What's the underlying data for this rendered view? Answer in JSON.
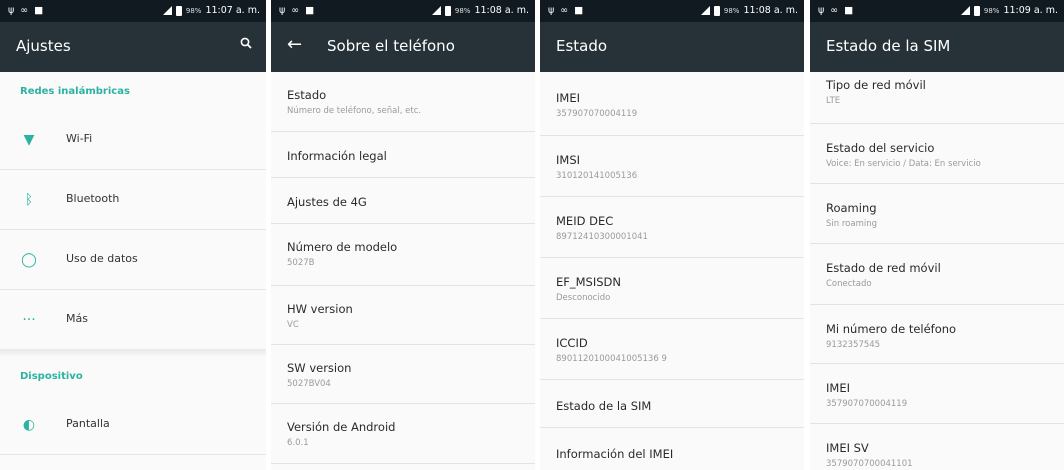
{
  "statusbar": {
    "battery": "98%",
    "times": [
      "11:07 a. m.",
      "11:08 a. m.",
      "11:08 a. m.",
      "11:09 a. m."
    ]
  },
  "screen1": {
    "title": "Ajustes",
    "section_wireless": "Redes inalámbricas",
    "items": [
      "Wi-Fi",
      "Bluetooth",
      "Uso de datos",
      "Más"
    ],
    "section_device": "Dispositivo",
    "device_items": [
      "Pantalla"
    ]
  },
  "screen2": {
    "title": "Sobre el teléfono",
    "items": [
      {
        "title": "Estado",
        "sub": "Número de teléfono, señal, etc."
      },
      {
        "title": "Información legal",
        "sub": ""
      },
      {
        "title": "Ajustes de 4G",
        "sub": ""
      },
      {
        "title": "Número de modelo",
        "sub": "5027B"
      },
      {
        "title": "HW version",
        "sub": "VC"
      },
      {
        "title": "SW version",
        "sub": "5027BV04"
      },
      {
        "title": "Versión de Android",
        "sub": "6.0.1"
      }
    ]
  },
  "screen3": {
    "title": "Estado",
    "items": [
      {
        "title": "IMEI",
        "sub": "357907070004119"
      },
      {
        "title": "IMSI",
        "sub": "310120141005136"
      },
      {
        "title": "MEID DEC",
        "sub": "89712410300001041"
      },
      {
        "title": "EF_MSISDN",
        "sub": "Desconocido"
      },
      {
        "title": "ICCID",
        "sub": "8901120100041005136 9"
      },
      {
        "title": "Estado de la SIM",
        "sub": ""
      },
      {
        "title": "Información del IMEI",
        "sub": ""
      }
    ]
  },
  "screen4": {
    "title": "Estado de la SIM",
    "items": [
      {
        "title": "Tipo de red móvil",
        "sub": "LTE"
      },
      {
        "title": "Estado del servicio",
        "sub": "Voice: En servicio / Data: En servicio"
      },
      {
        "title": "Roaming",
        "sub": "Sin roaming"
      },
      {
        "title": "Estado de red móvil",
        "sub": "Conectado"
      },
      {
        "title": "Mi número de teléfono",
        "sub": "9132357545"
      },
      {
        "title": "IMEI",
        "sub": "357907070004119"
      },
      {
        "title": "IMEI SV",
        "sub": "3579070700041101"
      }
    ]
  }
}
